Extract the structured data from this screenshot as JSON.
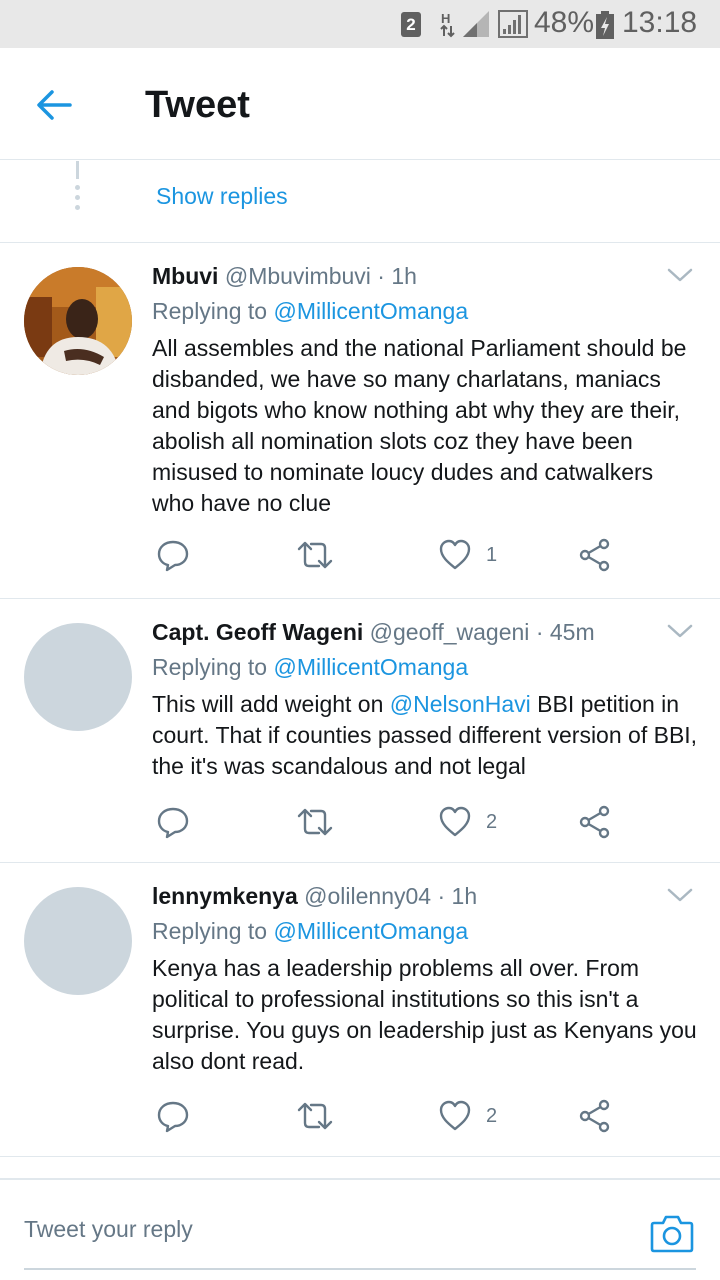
{
  "status_bar": {
    "sim_label": "2",
    "network_type": "H",
    "battery_percent": "48%",
    "time": "13:18"
  },
  "header": {
    "title": "Tweet",
    "back_icon": "arrow-left-icon"
  },
  "thread": {
    "show_replies_label": "Show replies"
  },
  "tweets": [
    {
      "name": "Mbuvi",
      "handle": "@Mbuvimbuvi",
      "dot": "·",
      "time": "1h",
      "replying_prefix": "Replying to",
      "replying_to": "@MillicentOmanga",
      "text": "All assembles and the national Parliament should be disbanded, we have so many charlatans, maniacs and bigots who know nothing abt why they are their, abolish all nomination slots coz they have been misused to nominate loucy dudes and catwalkers who have no clue",
      "likes": "1",
      "has_photo": true
    },
    {
      "name": "Capt. Geoff Wageni",
      "handle": "@geoff_wageni",
      "dot": "·",
      "time": "45m",
      "replying_prefix": "Replying to",
      "replying_to": "@MillicentOmanga",
      "text_before": "This will add weight on ",
      "text_mention": "@NelsonHavi",
      "text_after": " BBI petition in court. That if counties passed different version of BBI, the it's was scandalous and not legal",
      "likes": "2",
      "has_photo": false
    },
    {
      "name": "lennymkenya",
      "handle": "@olilenny04",
      "dot": "·",
      "time": "1h",
      "replying_prefix": "Replying to",
      "replying_to": "@MillicentOmanga",
      "text": "Kenya has a leadership problems all over. From political to professional institutions so this isn't a surprise. You guys on leadership just as Kenyans you also dont read.",
      "likes": "2",
      "has_photo": false
    }
  ],
  "compose": {
    "placeholder": "Tweet your reply",
    "camera_icon": "camera-icon"
  },
  "colors": {
    "accent": "#1b95e0",
    "text_primary": "#14171a",
    "text_secondary": "#657786",
    "divider": "#e1e8ed",
    "avatar_placeholder": "#ccd6dd"
  }
}
